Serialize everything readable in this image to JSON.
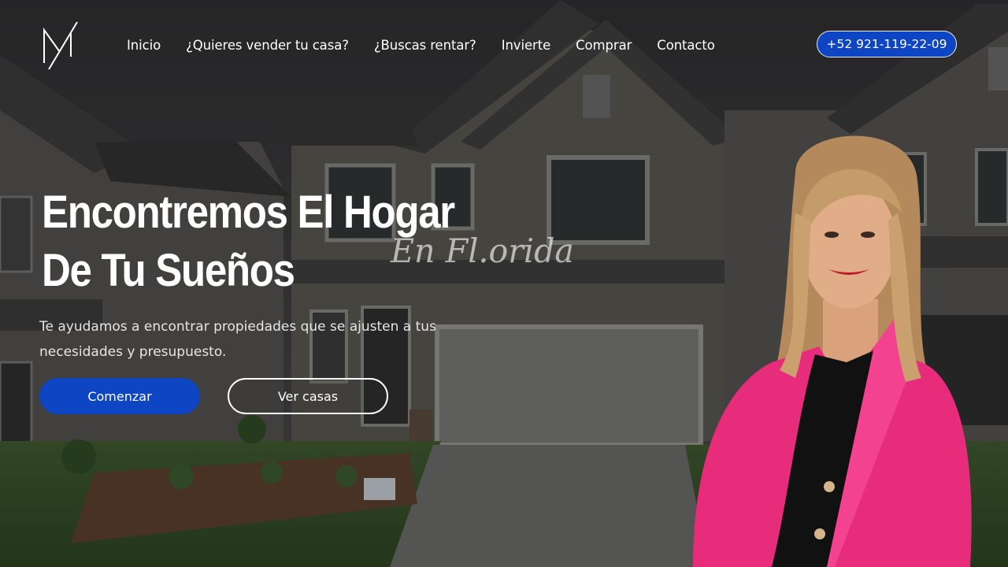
{
  "nav": {
    "logo_alt": "M logo",
    "items": [
      {
        "label": "Inicio"
      },
      {
        "label": "¿Quieres vender tu casa?"
      },
      {
        "label": "¿Buscas rentar?"
      },
      {
        "label": "Invierte"
      },
      {
        "label": "Comprar"
      },
      {
        "label": "Contacto"
      }
    ],
    "phone": "+52 921-119-22-09"
  },
  "hero": {
    "title_line1": "Encontremos El Hogar",
    "title_line2": "De Tu Sueños",
    "script_text": "En Fl.orida",
    "subtitle": "Te ayudamos a encontrar propiedades que se ajusten a tus necesidades y presupuesto.",
    "primary_button": "Comenzar",
    "secondary_button": "Ver casas"
  },
  "colors": {
    "accent": "#0d45c2",
    "jacket": "#e62c7a",
    "overlay": "#2e2e30"
  }
}
